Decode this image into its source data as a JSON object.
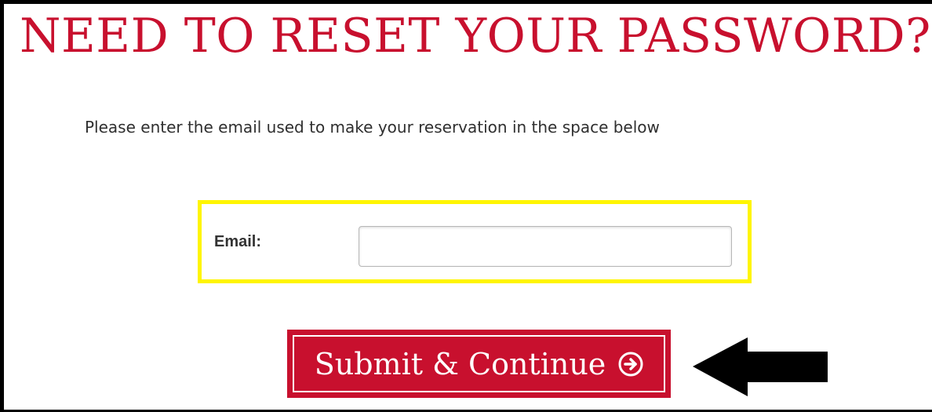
{
  "page": {
    "title": "NEED TO RESET YOUR PASSWORD?",
    "instruction": "Please enter the email used to make your reservation in the space below"
  },
  "form": {
    "email_label": "Email:",
    "email_value": "",
    "email_placeholder": ""
  },
  "submit": {
    "label": "Submit & Continue",
    "icon": "arrow-circle-right-icon"
  },
  "annotations": {
    "highlight_color": "#fff500",
    "pointer_icon": "arrow-left-icon",
    "pointer_color": "#000000"
  },
  "colors": {
    "brand_red": "#c8102e",
    "text_dark": "#2f2f2f"
  }
}
